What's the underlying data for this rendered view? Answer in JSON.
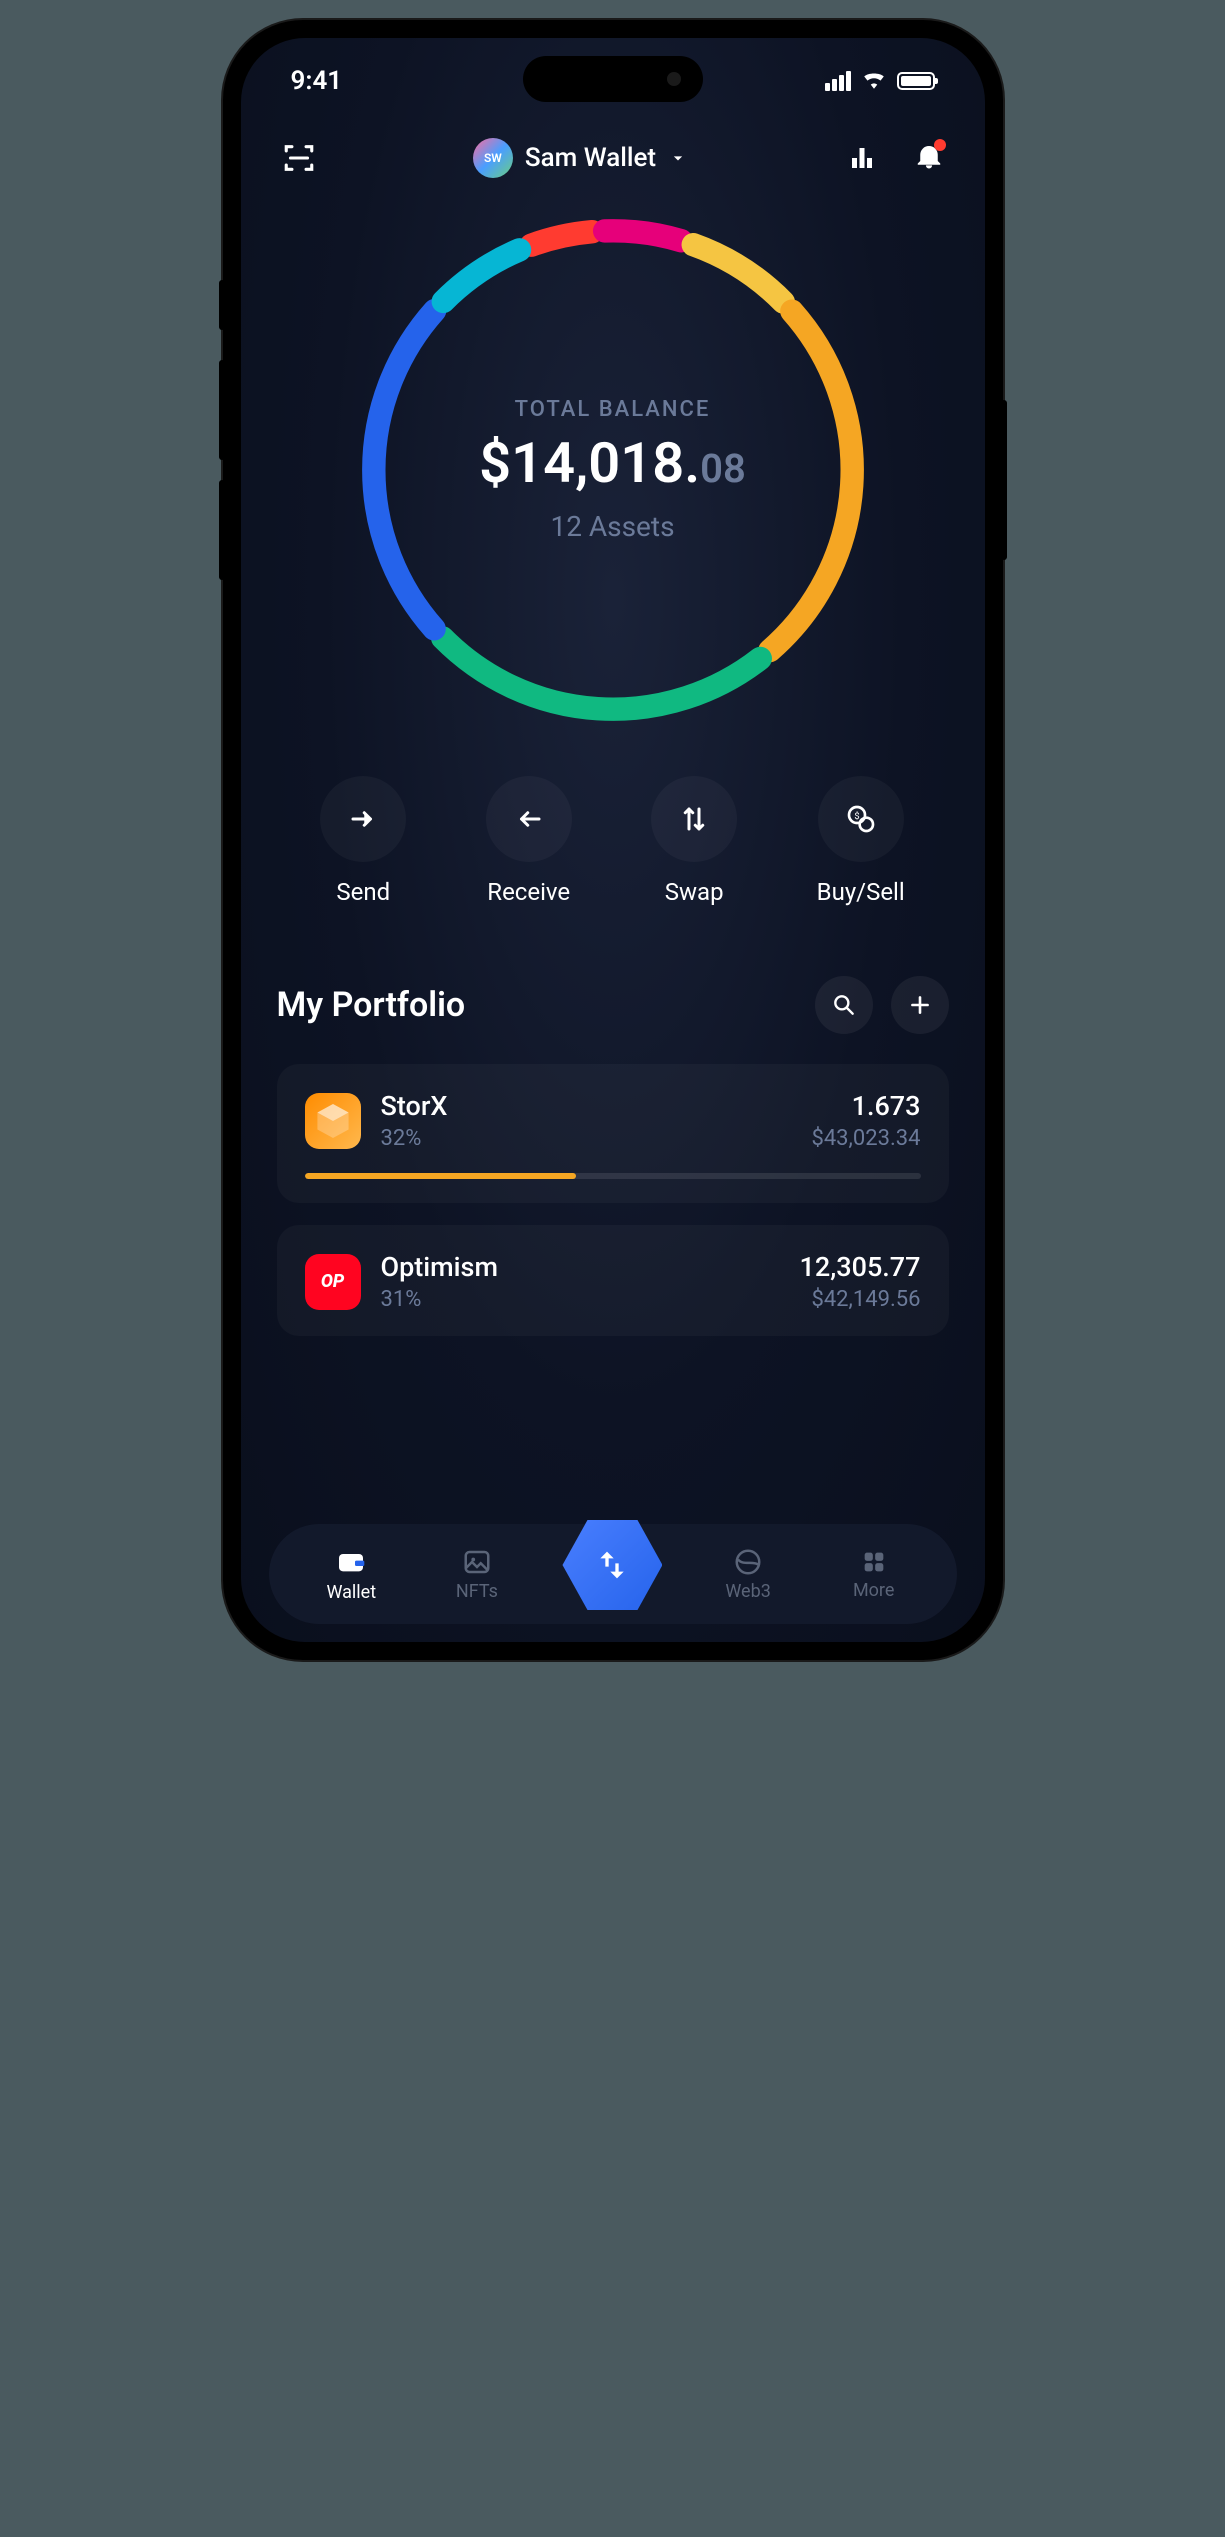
{
  "status": {
    "time": "9:41"
  },
  "header": {
    "wallet_initials": "SW",
    "wallet_name": "Sam Wallet"
  },
  "balance": {
    "label": "TOTAL BALANCE",
    "currency": "$",
    "major": "14,018.",
    "cents": "08",
    "assets_count": "12 Assets"
  },
  "actions": {
    "send": "Send",
    "receive": "Receive",
    "swap": "Swap",
    "buysell": "Buy/Sell"
  },
  "portfolio": {
    "title": "My Portfolio",
    "assets": [
      {
        "name": "StorX",
        "pct": "32%",
        "amount": "1.673",
        "usd": "$43,023.34",
        "bar_pct": 44,
        "bar_color": "#f5a623",
        "icon_bg": "linear-gradient(135deg,#ff8c00,#ffb84d)",
        "icon_label": ""
      },
      {
        "name": "Optimism",
        "pct": "31%",
        "amount": "12,305.77",
        "usd": "$42,149.56",
        "bar_pct": 0,
        "bar_color": "#ff0420",
        "icon_bg": "#ff0420",
        "icon_label": "OP"
      }
    ]
  },
  "nav": {
    "wallet": "Wallet",
    "nfts": "NFTs",
    "web3": "Web3",
    "more": "More"
  },
  "chart_data": {
    "type": "pie",
    "title": "Portfolio allocation",
    "series": [
      {
        "name": "segment-1",
        "value": 5,
        "color": "#ff3b30"
      },
      {
        "name": "segment-2",
        "value": 6,
        "color": "#e6007a"
      },
      {
        "name": "segment-3",
        "value": 8,
        "color": "#f5c542"
      },
      {
        "name": "segment-4",
        "value": 26,
        "color": "#f5a623"
      },
      {
        "name": "segment-5",
        "value": 24,
        "color": "#10b981"
      },
      {
        "name": "segment-6",
        "value": 24,
        "color": "#2563eb"
      },
      {
        "name": "segment-7",
        "value": 7,
        "color": "#06b6d4"
      }
    ]
  }
}
